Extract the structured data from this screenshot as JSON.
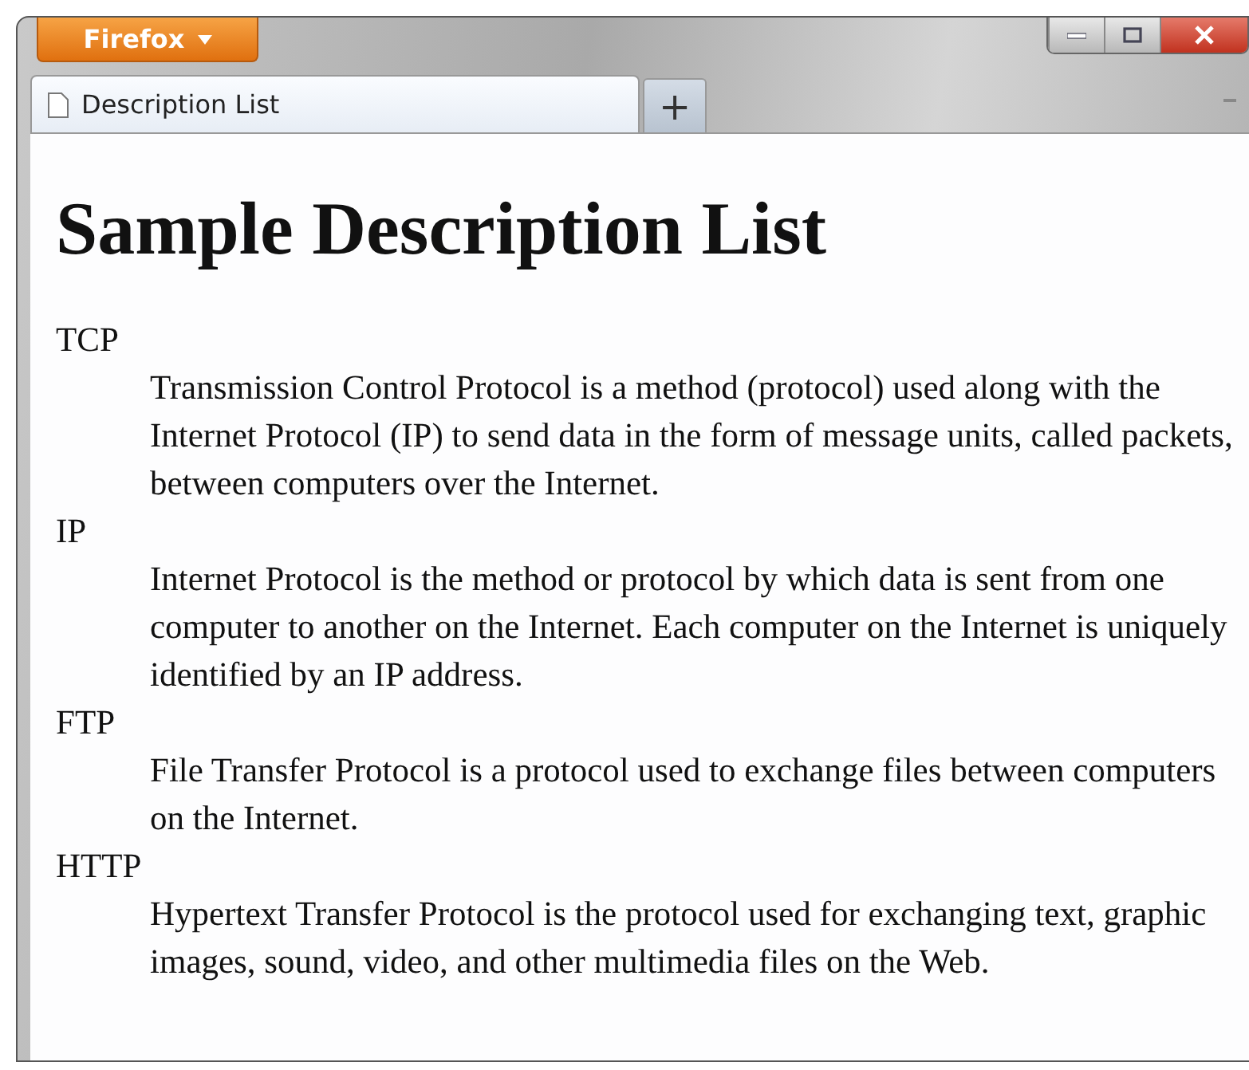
{
  "window": {
    "app_button": "Firefox"
  },
  "tabs": [
    {
      "label": "Description List",
      "selected": true
    }
  ],
  "new_tab": "+",
  "page": {
    "heading": "Sample Description List",
    "terms": [
      {
        "term": "TCP",
        "description": "Transmission Control Protocol is a method (protocol) used along with the Internet Protocol (IP) to send data in the form of message units, called packets, between computers over the Internet."
      },
      {
        "term": "IP",
        "description": "Internet Protocol is the method or protocol by which data is sent from one computer to another on the Internet. Each computer on the Internet is uniquely identified by an IP address."
      },
      {
        "term": "FTP",
        "description": "File Transfer Protocol is a protocol used to exchange files between computers on the Internet."
      },
      {
        "term": "HTTP",
        "description": "Hypertext Transfer Protocol is the protocol used for exchanging text, graphic images, sound, video, and other multimedia files on the Web."
      }
    ]
  }
}
